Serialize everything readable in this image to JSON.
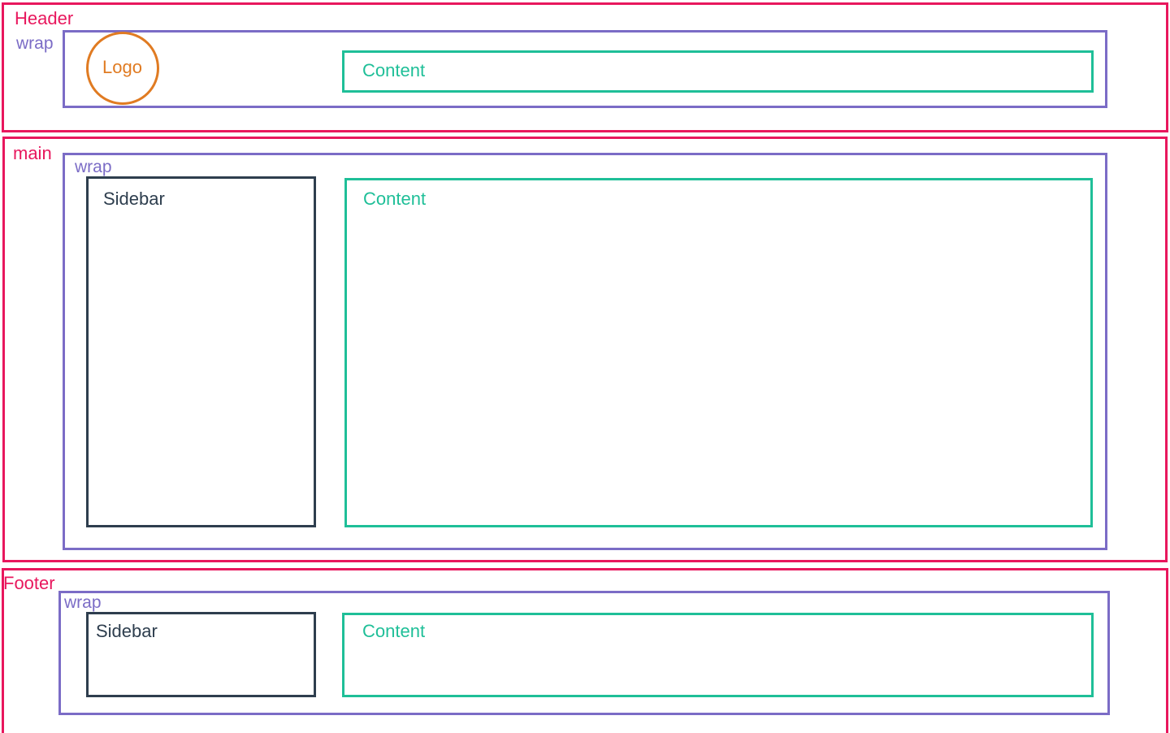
{
  "colors": {
    "region": "#e8175d",
    "wrap": "#7b6cc6",
    "logo": "#e07b22",
    "content": "#1fbf98",
    "sidebar": "#2e3e4e"
  },
  "header": {
    "label": "Header",
    "wrap_label": "wrap",
    "logo_label": "Logo",
    "content_label": "Content"
  },
  "main": {
    "label": "main",
    "wrap_label": "wrap",
    "sidebar_label": "Sidebar",
    "content_label": "Content"
  },
  "footer": {
    "label": "Footer",
    "wrap_label": "wrap",
    "sidebar_label": "Sidebar",
    "content_label": "Content"
  }
}
